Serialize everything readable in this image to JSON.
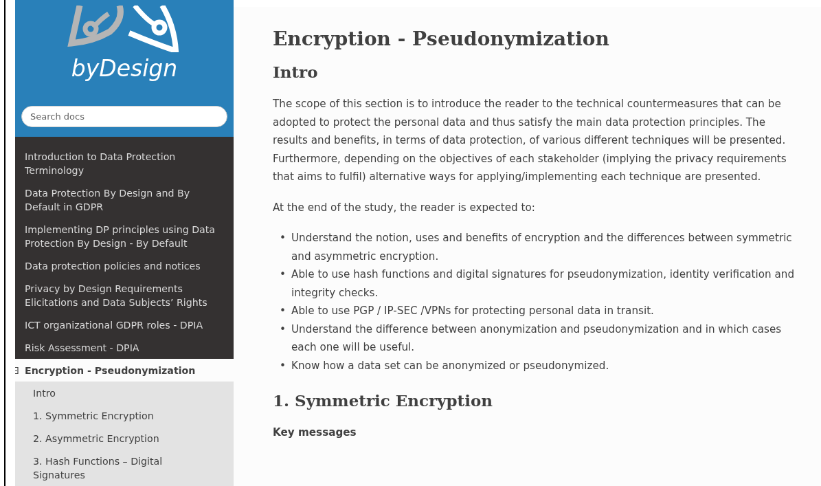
{
  "logo": {
    "text": "byDesign"
  },
  "search": {
    "placeholder": "Search docs"
  },
  "nav": [
    {
      "label": "Introduction to Data Protection Terminology",
      "selected": false
    },
    {
      "label": "Data Protection By Design and By Default in GDPR",
      "selected": false
    },
    {
      "label": "Implementing DP principles using Data Protection By Design - By Default",
      "selected": false
    },
    {
      "label": "Data protection policies and notices",
      "selected": false
    },
    {
      "label": "Privacy by Design Requirements Elicitations and Data Subjects’ Rights",
      "selected": false
    },
    {
      "label": "ICT organizational GDPR roles - DPIA",
      "selected": false
    },
    {
      "label": "Risk Assessment - DPIA",
      "selected": false
    },
    {
      "label": "Encryption - Pseudonymization",
      "selected": true,
      "expanded": true,
      "children": [
        {
          "label": "Intro"
        },
        {
          "label": "1. Symmetric Encryption"
        },
        {
          "label": "2. Asymmetric Encryption"
        },
        {
          "label": "3. Hash Functions – Digital Signatures"
        }
      ]
    }
  ],
  "content": [
    {
      "kind": "title",
      "text": "Encryption - Pseudonymization"
    },
    {
      "kind": "heading",
      "text": "Intro"
    },
    {
      "kind": "paragraph",
      "text": "The scope of this section is to introduce the reader to the technical countermeasures that can be adopted to protect the personal data and thus satisfy the main data protection principles. The results and benefits, in terms of data protection, of various different techniques will be presented. Furthermore, depending on the objectives of each stakeholder (implying the privacy requirements that aims to fulfil) alternative ways for applying/implementing each technique are presented."
    },
    {
      "kind": "paragraph",
      "text": "At the end of the study, the reader is expected to:"
    },
    {
      "kind": "list",
      "items": [
        {
          "marker": "•",
          "text": "Understand the notion, uses and benefits of encryption and the differences between symmetric and asymmetric encryption."
        },
        {
          "marker": "•",
          "text": "Able to use hash functions and digital signatures for pseudonymization, identity verification and integrity checks."
        },
        {
          "marker": "•",
          "text": "Able to use PGP / IP-SEC /VPNs for protecting personal data in transit."
        },
        {
          "marker": "•",
          "text": "Understand the difference between anonymization and pseudonymization and in which cases each one will be useful."
        },
        {
          "marker": "•",
          "text": "Know how a data set can be anonymized or pseudonymized."
        }
      ]
    },
    {
      "kind": "heading",
      "text": "1. Symmetric Encryption"
    },
    {
      "kind": "label",
      "text": "Key messages"
    }
  ]
}
